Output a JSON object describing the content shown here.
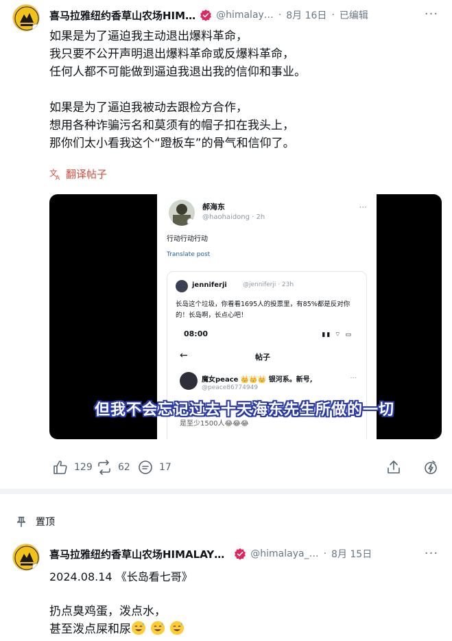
{
  "post1": {
    "author": "喜马拉雅纽约香草山农场HIM…",
    "handle": "@himalay…",
    "separator": "·",
    "date": "8月 16日",
    "edited": "已编辑",
    "text": "如果是为了逼迫我主动退出爆料革命，\n我只要不公开声明退出爆料革命或反爆料革命，\n任何人都不可能做到逼迫我退出我的信仰和事业。\n\n如果是为了逼迫我被动去跟检方合作，\n想用各种诈骗污名和莫须有的帽子扣在我头上，\n那你们太小看我这个“蹬板车”的骨气和信仰了。",
    "translate_label": "翻译帖子",
    "video": {
      "embedded_author": "郝海东",
      "embedded_handle": "@haohaidong · 2h",
      "embedded_text": "行动行动行动",
      "embedded_translate": "Translate post",
      "quote_author": "jenniferji",
      "quote_handle": "@jenniferji · 23h",
      "quote_text": "长岛这个垃圾，你看看1695人的投票里，有85%都是反对你的！长岛啊，长点心吧！",
      "phone_time": "08:00",
      "phone_status": "▮▮ ⌔ ▭",
      "page_back": "←",
      "page_title": "帖子",
      "inner_author": "魔女peace 👑👑👑 银河系。新号,",
      "inner_handle": "@peace86774949",
      "inner_more": "···",
      "inner_bottom": "是至少1500人😂😂😂",
      "subtitle": "但我不会忘记过去十天海东先生所做的一切"
    },
    "actions": {
      "likes": "129",
      "reposts": "62",
      "comments": "17"
    }
  },
  "pinned_label": "置顶",
  "post2": {
    "author": "喜马拉雅纽约香草山农场HIMALAY…",
    "handle": "@himalaya_…",
    "separator": "·",
    "date": "8月 15日",
    "text_line1": "2024.08.14 《长岛看七哥》",
    "text_line2": "扔点臭鸡蛋，泼点水，",
    "text_line3": "甚至泼点屎和尿"
  },
  "colors": {
    "verified_badge": "#e0245e",
    "translate_link": "#d64a3a",
    "subtitle_outline": "#2a3aa8",
    "avatar_bg": "#f2c21b",
    "muted_text": "#657786"
  },
  "icons": {
    "like": "thumbs-up-icon",
    "repost": "repost-icon",
    "comment": "comment-icon",
    "share": "share-icon",
    "boost": "boost-icon",
    "pin": "pin-icon",
    "translate": "translate-icon",
    "more": "more-icon"
  }
}
